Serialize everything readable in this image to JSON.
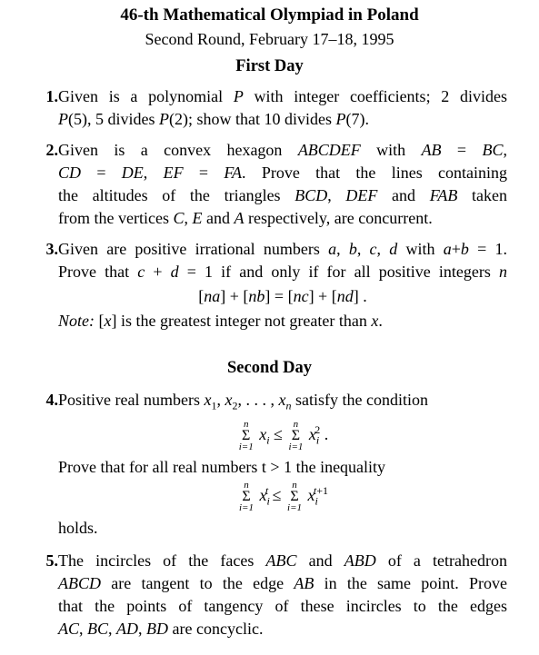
{
  "header": {
    "title": "46-th Mathematical Olympiad in Poland",
    "subtitle": "Second Round, February 17–18, 1995"
  },
  "days": [
    {
      "label": "First Day"
    },
    {
      "label": "Second Day"
    }
  ],
  "problems": [
    {
      "number": "1.",
      "lines": [
        "Given is a polynomial P with integer coefficients; 2 divides",
        "P(5), 5 divides P(2); show that 10 divides P(7)."
      ]
    },
    {
      "number": "2.",
      "lines": [
        "Given is a convex hexagon ABCDEF with AB = BC,",
        "CD = DE, EF = FA. Prove that the lines containing",
        "the altitudes of the triangles BCD, DEF and FAB taken",
        "from the vertices C, E and A respectively, are concurrent."
      ]
    },
    {
      "number": "3.",
      "lines": [
        "Given are positive irrational numbers a, b, c, d with a+b = 1.",
        "Prove that c + d = 1 if and only if for all positive integers n"
      ],
      "formula": "[na] + [nb] = [nc] + [nd] .",
      "note_label": "Note:",
      "note": "[x] is the greatest integer not greater than x."
    },
    {
      "number": "4.",
      "lines": [
        "Positive real numbers x1, x2, . . . , xn satisfy the condition"
      ],
      "formula1": "Σ(i=1..n) xi ≤ Σ(i=1..n) xi^2 .",
      "middle": "Prove that for all real numbers t > 1 the inequality",
      "formula2": "Σ(i=1..n) xi^t ≤ Σ(i=1..n) xi^(t+1)",
      "end": "holds."
    },
    {
      "number": "5.",
      "lines": [
        "The incircles of the faces ABC and ABD of a tetrahedron",
        "ABCD are tangent to the edge AB in the same point. Prove",
        "that the points of tangency of these incircles to the edges",
        "AC, BC, AD, BD are concyclic."
      ]
    }
  ],
  "sum_limits": {
    "upper": "n",
    "lower": "i=1",
    "sigma": "Σ"
  }
}
